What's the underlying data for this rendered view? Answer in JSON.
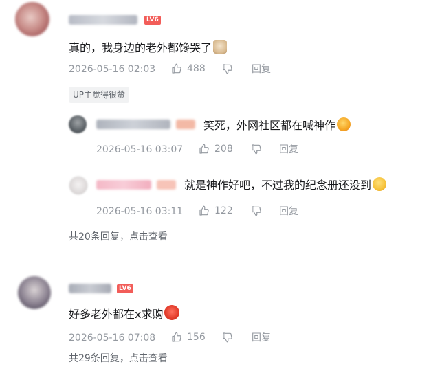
{
  "comments": [
    {
      "level": "LV6",
      "text": "真的，我身边的老外都馋哭了",
      "time": "2026-05-16 02:03",
      "likes": "488",
      "reply_label": "回复",
      "badge": "UP主觉得很赞",
      "replies": [
        {
          "text": "笑死，外网社区都在喊神作",
          "time": "2026-05-16 03:07",
          "likes": "208",
          "reply_label": "回复"
        },
        {
          "text": "就是神作好吧，不过我的纪念册还没到",
          "time": "2026-05-16 03:11",
          "likes": "122",
          "reply_label": "回复"
        }
      ],
      "more_replies": "共20条回复，点击查看"
    },
    {
      "level": "LV6",
      "text": "好多老外都在x求购",
      "time": "2026-05-16 07:08",
      "likes": "156",
      "reply_label": "回复",
      "more_replies": "共29条回复，点击查看"
    }
  ],
  "colors": {
    "level_badge": "#f25d59",
    "meta_text": "#9499a0",
    "content_text": "#18191c",
    "divider": "#e3e5e7"
  }
}
